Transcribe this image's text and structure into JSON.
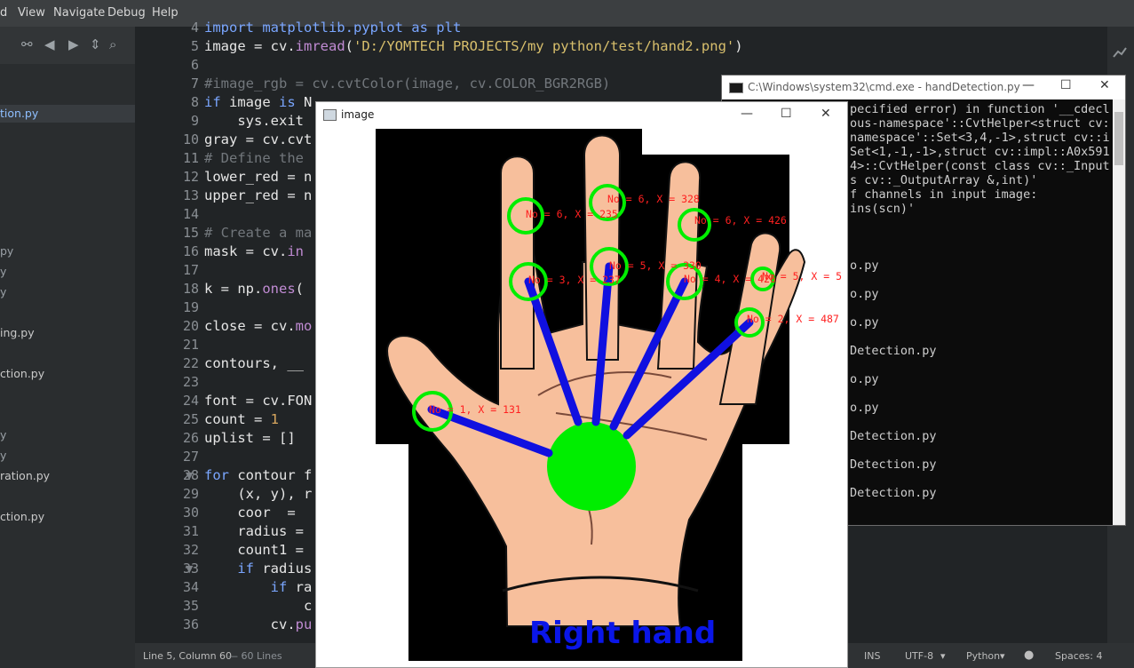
{
  "menubar": {
    "items": [
      "d",
      "View",
      "Navigate",
      "Debug",
      "Help"
    ]
  },
  "sidebar": {
    "files": [
      {
        "label": "tion.py",
        "selected": true
      },
      {
        "label": "py"
      },
      {
        "label": "y"
      },
      {
        "label": "y"
      },
      {
        "label": "ing.py"
      },
      {
        "label": "ction.py"
      },
      {
        "label": "y"
      },
      {
        "label": "y"
      },
      {
        "label": "ration.py"
      },
      {
        "label": "ction.py"
      }
    ]
  },
  "editor": {
    "lines": [
      {
        "no": "4",
        "fold": "",
        "segments": [
          {
            "t": "import matplotlib.pyplot as plt",
            "c": "kwline"
          }
        ]
      },
      {
        "no": "5",
        "fold": "",
        "segments": [
          {
            "t": "image = cv.",
            "c": ""
          },
          {
            "t": "imread",
            "c": "fn"
          },
          {
            "t": "(",
            "c": ""
          },
          {
            "t": "'D:/YOMTECH PROJECTS/my python/test/hand2.png'",
            "c": "st"
          },
          {
            "t": ")",
            "c": ""
          }
        ]
      },
      {
        "no": "6",
        "fold": "",
        "segments": []
      },
      {
        "no": "7",
        "fold": "",
        "segments": [
          {
            "t": "#image_rgb = cv.cvtColor(image, cv.COLOR_BGR2RGB)",
            "c": "cm"
          }
        ]
      },
      {
        "no": "8",
        "fold": "",
        "segments": [
          {
            "t": "if",
            "c": "kw"
          },
          {
            "t": " image ",
            "c": ""
          },
          {
            "t": "is",
            "c": "kw"
          },
          {
            "t": " N",
            "c": ""
          }
        ]
      },
      {
        "no": "9",
        "fold": "",
        "segments": [
          {
            "t": "    sys.exit",
            "c": ""
          }
        ]
      },
      {
        "no": "10",
        "fold": "",
        "segments": [
          {
            "t": "gray = cv.cvt",
            "c": ""
          }
        ]
      },
      {
        "no": "11",
        "fold": "",
        "segments": [
          {
            "t": "# Define the",
            "c": "cm"
          }
        ]
      },
      {
        "no": "12",
        "fold": "",
        "segments": [
          {
            "t": "lower_red = n",
            "c": ""
          }
        ]
      },
      {
        "no": "13",
        "fold": "",
        "segments": [
          {
            "t": "upper_red = n",
            "c": ""
          }
        ]
      },
      {
        "no": "14",
        "fold": "",
        "segments": []
      },
      {
        "no": "15",
        "fold": "",
        "segments": [
          {
            "t": "# Create a ma",
            "c": "cm"
          }
        ]
      },
      {
        "no": "16",
        "fold": "",
        "segments": [
          {
            "t": "mask = cv.",
            "c": ""
          },
          {
            "t": "in",
            "c": "fn"
          }
        ]
      },
      {
        "no": "17",
        "fold": "",
        "segments": []
      },
      {
        "no": "18",
        "fold": "",
        "segments": [
          {
            "t": "k = np.",
            "c": ""
          },
          {
            "t": "ones",
            "c": "fn"
          },
          {
            "t": "(",
            "c": ""
          }
        ]
      },
      {
        "no": "19",
        "fold": "",
        "segments": []
      },
      {
        "no": "20",
        "fold": "",
        "segments": [
          {
            "t": "close = cv.",
            "c": ""
          },
          {
            "t": "mo",
            "c": "fn"
          }
        ]
      },
      {
        "no": "21",
        "fold": "",
        "segments": []
      },
      {
        "no": "22",
        "fold": "",
        "segments": [
          {
            "t": "contours, __",
            "c": ""
          }
        ]
      },
      {
        "no": "23",
        "fold": "",
        "segments": []
      },
      {
        "no": "24",
        "fold": "",
        "segments": [
          {
            "t": "font = cv.FON",
            "c": ""
          }
        ]
      },
      {
        "no": "25",
        "fold": "",
        "segments": [
          {
            "t": "count = ",
            "c": ""
          },
          {
            "t": "1",
            "c": "nm"
          }
        ]
      },
      {
        "no": "26",
        "fold": "",
        "segments": [
          {
            "t": "uplist = []",
            "c": ""
          }
        ]
      },
      {
        "no": "27",
        "fold": "",
        "segments": []
      },
      {
        "no": "28",
        "fold": "▼",
        "segments": [
          {
            "t": "for",
            "c": "kw"
          },
          {
            "t": " contour f",
            "c": ""
          }
        ]
      },
      {
        "no": "29",
        "fold": "",
        "segments": [
          {
            "t": "    (x, y), r",
            "c": ""
          }
        ]
      },
      {
        "no": "30",
        "fold": "",
        "segments": [
          {
            "t": "    coor  = ",
            "c": ""
          }
        ]
      },
      {
        "no": "31",
        "fold": "",
        "segments": [
          {
            "t": "    radius = ",
            "c": ""
          }
        ]
      },
      {
        "no": "32",
        "fold": "",
        "segments": [
          {
            "t": "    count1 = ",
            "c": ""
          }
        ]
      },
      {
        "no": "33",
        "fold": "▼",
        "segments": [
          {
            "t": "    ",
            "c": ""
          },
          {
            "t": "if",
            "c": "kw"
          },
          {
            "t": " radius",
            "c": ""
          }
        ]
      },
      {
        "no": "34",
        "fold": "",
        "segments": [
          {
            "t": "        ",
            "c": ""
          },
          {
            "t": "if",
            "c": "kw"
          },
          {
            "t": " ra",
            "c": ""
          }
        ]
      },
      {
        "no": "35",
        "fold": "",
        "segments": [
          {
            "t": "            c",
            "c": ""
          }
        ]
      },
      {
        "no": "36",
        "fold": "",
        "segments": [
          {
            "t": "        cv.",
            "c": ""
          },
          {
            "t": "pu",
            "c": "fn"
          }
        ]
      }
    ]
  },
  "statusbar": {
    "position": "Line 5, Column 60",
    "lines": " — 60 Lines",
    "ins": "INS",
    "encoding": "UTF-8",
    "language": "Python",
    "spaces": "Spaces: 4"
  },
  "cmd": {
    "title": "C:\\Windows\\system32\\cmd.exe - handDetection.py",
    "lines": [
      "pecified error) in function '__cdecl",
      "ous-namespace'::CvtHelper<struct cv:",
      "namespace'::Set<3,4,-1>,struct cv::i",
      "Set<1,-1,-1>,struct cv::impl::A0x591",
      "4>::CvtHelper(const class cv::_Input",
      "s cv::_OutputArray &,int)'",
      "f channels in input image:",
      "ins(scn)'",
      "",
      "",
      "",
      "o.py",
      "",
      "o.py",
      "",
      "o.py",
      "",
      "Detection.py",
      "",
      "o.py",
      "",
      "o.py",
      "",
      "Detection.py",
      "",
      "Detection.py",
      "",
      "Detection.py"
    ]
  },
  "image_window": {
    "title": "image",
    "hand_label": "Right hand",
    "colors": {
      "skin": "#f7bf9c",
      "marker": "#00ee00",
      "line": "#1010e0",
      "text": "#ff2020",
      "bg": "#000000"
    },
    "detections": [
      {
        "label": "No = 1, X = 131"
      },
      {
        "label": "No = 2, X = 487"
      },
      {
        "label": "No = 3, X = 237"
      },
      {
        "label": "No = 4, X = 426"
      },
      {
        "label": "No = 5, X = 330"
      },
      {
        "label": "No = 5, X = 5"
      },
      {
        "label": "No = 6, X = 235"
      },
      {
        "label": "No = 6, X = 328"
      },
      {
        "label": "No = 6, X = 426"
      }
    ]
  }
}
